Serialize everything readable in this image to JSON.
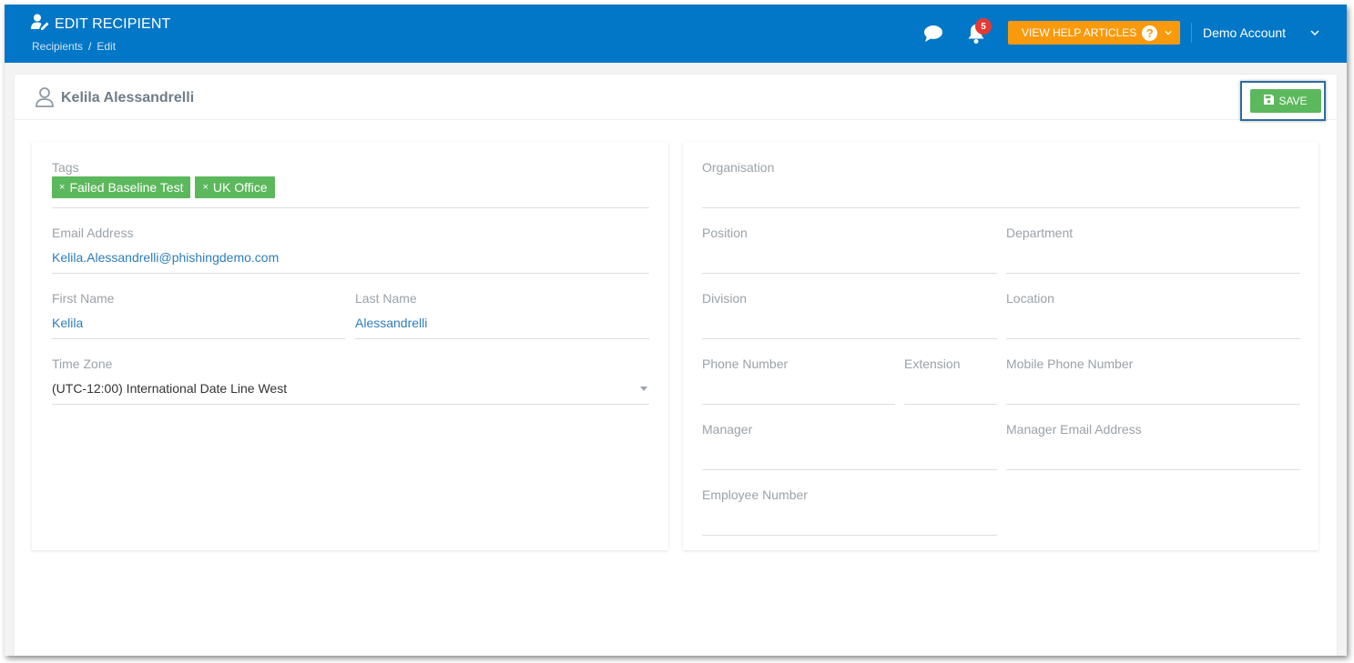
{
  "header": {
    "title": "EDIT RECIPIENT",
    "breadcrumb": [
      "Recipients",
      "Edit"
    ],
    "breadcrumb_separator": "/",
    "notifications_count": "5",
    "help_label": "VIEW HELP ARTICLES",
    "help_icon_glyph": "?",
    "account_name": "Demo Account",
    "colors": {
      "bar": "#0277c7",
      "help": "#f99a0d",
      "badge": "#e53935"
    }
  },
  "card": {
    "recipient_name": "Kelila Alessandrelli",
    "save_label": "SAVE"
  },
  "left_panel": {
    "tags": {
      "label": "Tags",
      "items": [
        "Failed Baseline Test",
        "UK Office"
      ],
      "remove_glyph": "×"
    },
    "email": {
      "label": "Email Address",
      "value": "Kelila.Alessandrelli@phishingdemo.com"
    },
    "first_name": {
      "label": "First Name",
      "value": "Kelila"
    },
    "last_name": {
      "label": "Last Name",
      "value": "Alessandrelli"
    },
    "time_zone": {
      "label": "Time Zone",
      "value": "(UTC-12:00) International Date Line West"
    }
  },
  "right_panel": {
    "organisation": {
      "label": "Organisation",
      "value": ""
    },
    "position": {
      "label": "Position",
      "value": ""
    },
    "department": {
      "label": "Department",
      "value": ""
    },
    "division": {
      "label": "Division",
      "value": ""
    },
    "location": {
      "label": "Location",
      "value": ""
    },
    "phone": {
      "label": "Phone Number",
      "value": ""
    },
    "extension": {
      "label": "Extension",
      "value": ""
    },
    "mobile": {
      "label": "Mobile Phone Number",
      "value": ""
    },
    "manager": {
      "label": "Manager",
      "value": ""
    },
    "manager_email": {
      "label": "Manager Email Address",
      "value": ""
    },
    "employee_number": {
      "label": "Employee Number",
      "value": ""
    }
  },
  "icons": [
    "user-edit-icon",
    "chat-icon",
    "bell-icon",
    "question-icon",
    "chevron-down-icon",
    "user-icon",
    "floppy-disk-icon",
    "close-icon",
    "dropdown-caret-icon"
  ]
}
